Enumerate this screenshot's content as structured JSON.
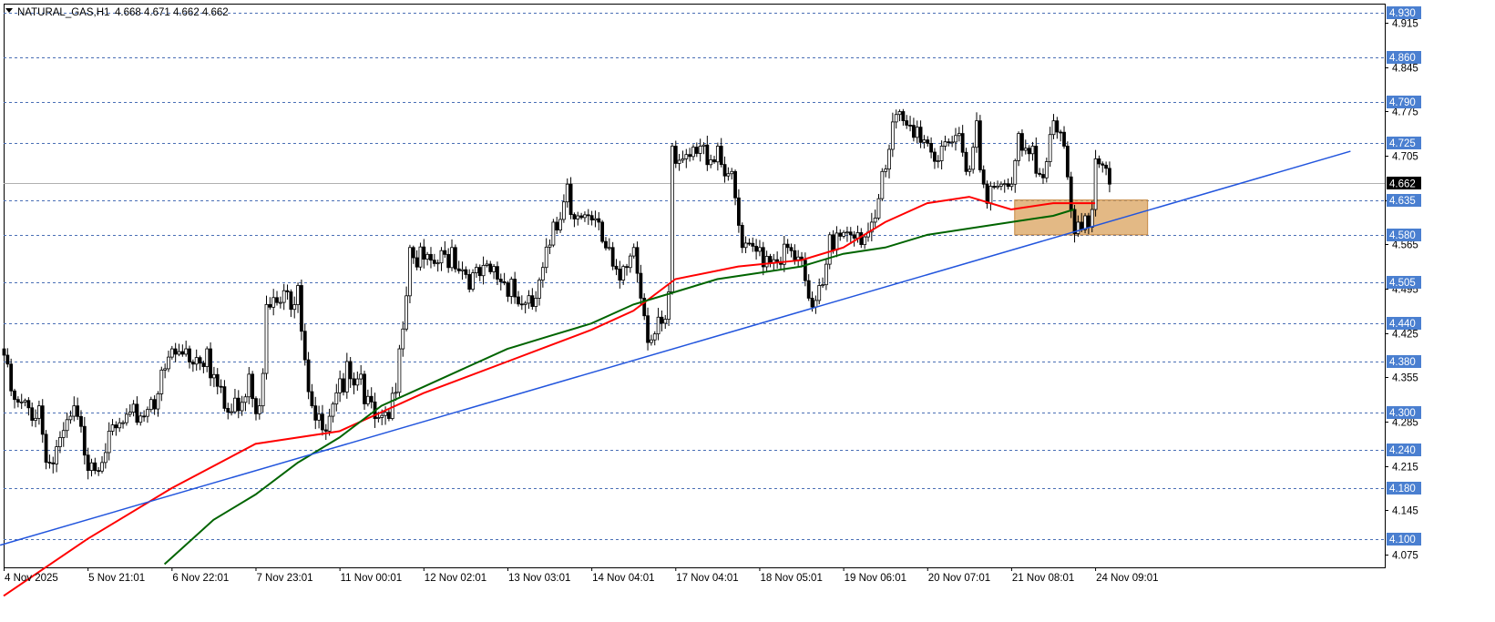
{
  "header": {
    "symbol": "NATURAL_GAS,H1",
    "ohlc": "4.668 4.671 4.662 4.662"
  },
  "colors": {
    "background": "#ffffff",
    "candle": "#000000",
    "grid_level": "#4a6fb5",
    "level_tag": "#4a7fd0",
    "current_tag": "#000000",
    "ma_fast": "#ff0000",
    "ma_slow": "#006400",
    "trendline": "#2255dd",
    "zone_fill": "#d9a15c"
  },
  "chart_data": {
    "type": "candlestick",
    "title": "NATURAL_GAS,H1",
    "ylim": [
      4.055,
      4.945
    ],
    "y_ticks": [
      "4.915",
      "4.845",
      "4.775",
      "4.705",
      "4.635",
      "4.565",
      "4.495",
      "4.425",
      "4.355",
      "4.285",
      "4.215",
      "4.145",
      "4.075"
    ],
    "x_labels": [
      "4 Nov 2025",
      "5 Nov 21:01",
      "6 Nov 22:01",
      "7 Nov 23:01",
      "11 Nov 00:01",
      "12 Nov 02:01",
      "13 Nov 03:01",
      "14 Nov 04:01",
      "17 Nov 04:01",
      "18 Nov 05:01",
      "19 Nov 06:01",
      "20 Nov 07:01",
      "21 Nov 08:01",
      "24 Nov 09:01"
    ],
    "x_label_positions": [
      0,
      24,
      48,
      72,
      96,
      120,
      144,
      168,
      192,
      216,
      240,
      264,
      288,
      312
    ],
    "levels": [
      "4.930",
      "4.860",
      "4.790",
      "4.725",
      "4.635",
      "4.580",
      "4.505",
      "4.440",
      "4.380",
      "4.300",
      "4.240",
      "4.180",
      "4.100"
    ],
    "current_price": "4.662",
    "anchors": [
      {
        "x": 0,
        "y": 4.39
      },
      {
        "x": 3,
        "y": 4.32
      },
      {
        "x": 10,
        "y": 4.31
      },
      {
        "x": 13,
        "y": 4.22
      },
      {
        "x": 16,
        "y": 4.26
      },
      {
        "x": 20,
        "y": 4.31
      },
      {
        "x": 25,
        "y": 4.22
      },
      {
        "x": 30,
        "y": 4.27
      },
      {
        "x": 36,
        "y": 4.3
      },
      {
        "x": 42,
        "y": 4.32
      },
      {
        "x": 48,
        "y": 4.4
      },
      {
        "x": 52,
        "y": 4.4
      },
      {
        "x": 58,
        "y": 4.4
      },
      {
        "x": 64,
        "y": 4.3
      },
      {
        "x": 70,
        "y": 4.36
      },
      {
        "x": 73,
        "y": 4.31
      },
      {
        "x": 75,
        "y": 4.47
      },
      {
        "x": 81,
        "y": 4.49
      },
      {
        "x": 84,
        "y": 4.5
      },
      {
        "x": 88,
        "y": 4.31
      },
      {
        "x": 92,
        "y": 4.27
      },
      {
        "x": 98,
        "y": 4.38
      },
      {
        "x": 102,
        "y": 4.36
      },
      {
        "x": 106,
        "y": 4.29
      },
      {
        "x": 110,
        "y": 4.29
      },
      {
        "x": 113,
        "y": 4.4
      },
      {
        "x": 116,
        "y": 4.56
      },
      {
        "x": 122,
        "y": 4.54
      },
      {
        "x": 128,
        "y": 4.56
      },
      {
        "x": 134,
        "y": 4.52
      },
      {
        "x": 140,
        "y": 4.53
      },
      {
        "x": 145,
        "y": 4.51
      },
      {
        "x": 148,
        "y": 4.47
      },
      {
        "x": 152,
        "y": 4.48
      },
      {
        "x": 157,
        "y": 4.6
      },
      {
        "x": 161,
        "y": 4.66
      },
      {
        "x": 164,
        "y": 4.61
      },
      {
        "x": 170,
        "y": 4.6
      },
      {
        "x": 173,
        "y": 4.56
      },
      {
        "x": 177,
        "y": 4.53
      },
      {
        "x": 180,
        "y": 4.56
      },
      {
        "x": 182,
        "y": 4.48
      },
      {
        "x": 184,
        "y": 4.41
      },
      {
        "x": 187,
        "y": 4.45
      },
      {
        "x": 190,
        "y": 4.49
      },
      {
        "x": 191,
        "y": 4.72
      },
      {
        "x": 194,
        "y": 4.7
      },
      {
        "x": 199,
        "y": 4.72
      },
      {
        "x": 204,
        "y": 4.72
      },
      {
        "x": 208,
        "y": 4.68
      },
      {
        "x": 211,
        "y": 4.56
      },
      {
        "x": 216,
        "y": 4.56
      },
      {
        "x": 224,
        "y": 4.56
      },
      {
        "x": 228,
        "y": 4.54
      },
      {
        "x": 230,
        "y": 4.48
      },
      {
        "x": 233,
        "y": 4.5
      },
      {
        "x": 236,
        "y": 4.58
      },
      {
        "x": 242,
        "y": 4.58
      },
      {
        "x": 248,
        "y": 4.6
      },
      {
        "x": 251,
        "y": 4.68
      },
      {
        "x": 255,
        "y": 4.77
      },
      {
        "x": 261,
        "y": 4.75
      },
      {
        "x": 268,
        "y": 4.72
      },
      {
        "x": 273,
        "y": 4.74
      },
      {
        "x": 275,
        "y": 4.68
      },
      {
        "x": 278,
        "y": 4.76
      },
      {
        "x": 280,
        "y": 4.66
      },
      {
        "x": 285,
        "y": 4.66
      },
      {
        "x": 288,
        "y": 4.66
      },
      {
        "x": 290,
        "y": 4.74
      },
      {
        "x": 294,
        "y": 4.72
      },
      {
        "x": 297,
        "y": 4.67
      },
      {
        "x": 300,
        "y": 4.76
      },
      {
        "x": 303,
        "y": 4.72
      },
      {
        "x": 305,
        "y": 4.62
      },
      {
        "x": 307,
        "y": 4.6
      },
      {
        "x": 309,
        "y": 4.61
      },
      {
        "x": 311,
        "y": 4.62
      },
      {
        "x": 312,
        "y": 4.7
      },
      {
        "x": 314,
        "y": 4.69
      },
      {
        "x": 316,
        "y": 4.66
      }
    ],
    "series": [
      {
        "name": "",
        "values": [
          [
            0,
            4.01
          ],
          [
            24,
            4.1
          ],
          [
            48,
            4.18
          ],
          [
            72,
            4.25
          ],
          [
            96,
            4.27
          ],
          [
            120,
            4.33
          ],
          [
            144,
            4.38
          ],
          [
            168,
            4.43
          ],
          [
            180,
            4.46
          ],
          [
            192,
            4.51
          ],
          [
            210,
            4.53
          ],
          [
            228,
            4.54
          ],
          [
            240,
            4.56
          ],
          [
            252,
            4.6
          ],
          [
            264,
            4.63
          ],
          [
            276,
            4.64
          ],
          [
            288,
            4.62
          ],
          [
            300,
            4.63
          ],
          [
            312,
            4.63
          ]
        ]
      },
      {
        "name": "",
        "values": [
          [
            46,
            4.06
          ],
          [
            60,
            4.13
          ],
          [
            72,
            4.17
          ],
          [
            84,
            4.22
          ],
          [
            96,
            4.26
          ],
          [
            108,
            4.31
          ],
          [
            120,
            4.34
          ],
          [
            132,
            4.37
          ],
          [
            144,
            4.4
          ],
          [
            156,
            4.42
          ],
          [
            168,
            4.44
          ],
          [
            180,
            4.47
          ],
          [
            192,
            4.49
          ],
          [
            204,
            4.51
          ],
          [
            216,
            4.52
          ],
          [
            228,
            4.53
          ],
          [
            240,
            4.55
          ],
          [
            252,
            4.56
          ],
          [
            264,
            4.58
          ],
          [
            276,
            4.59
          ],
          [
            288,
            4.6
          ],
          [
            300,
            4.61
          ],
          [
            306,
            4.62
          ]
        ]
      }
    ],
    "trendline": [
      [
        -1,
        4.09
      ],
      [
        385,
        4.712
      ]
    ],
    "zone": {
      "x": [
        289,
        327
      ],
      "y": [
        4.58,
        4.635
      ]
    }
  }
}
